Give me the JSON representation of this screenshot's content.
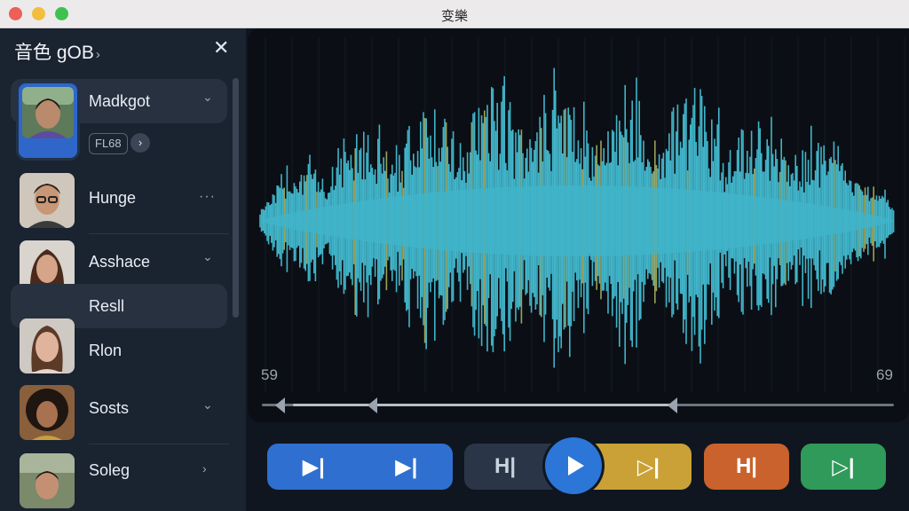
{
  "window": {
    "title": "变樂"
  },
  "sidebar": {
    "title": "音色 gOB",
    "title_arrow": "›",
    "close_glyph": "✕",
    "voices": [
      {
        "name": "Madkgot",
        "accessory": "chevron",
        "tag": "FL68"
      },
      {
        "name": "Hunge",
        "accessory": "dots"
      },
      {
        "name": "Asshace",
        "accessory": "chevron"
      },
      {
        "name": "Resll",
        "accessory": "none"
      },
      {
        "name": "Rlon",
        "accessory": "none"
      },
      {
        "name": "Sosts",
        "accessory": "chevron"
      },
      {
        "name": "Soleg",
        "accessory": "chevron-right"
      }
    ],
    "tag_button_glyph": "›",
    "chevron_down": "⌄",
    "chevron_right": "›",
    "dots": "···"
  },
  "waveform": {
    "start_time": "59",
    "end_time": "69",
    "color": "#41b4c9"
  },
  "controls": {
    "blue_left_label": "▶|",
    "blue_right_label": "▶|",
    "dark_label": "H|",
    "yellow_label": "▷|",
    "orange_label": "H|",
    "green_label": "▷|",
    "colors": {
      "blue": "#2f6fd0",
      "dark": "#2a3647",
      "yellow": "#c9a136",
      "orange": "#c9622c",
      "green": "#2f9a59",
      "play": "#2c76d8"
    }
  }
}
